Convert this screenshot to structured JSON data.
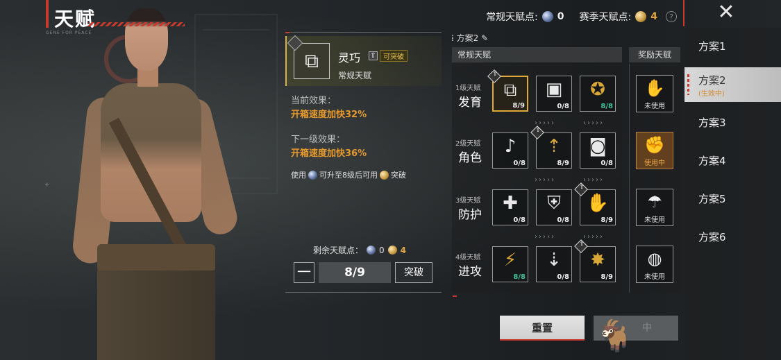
{
  "header": {
    "title": "天赋",
    "subtitle": "GENE FOR PEACE",
    "normal_points_label": "常规天赋点:",
    "normal_points_value": "0",
    "season_points_label": "赛季天赋点:",
    "season_points_value": "4",
    "help_icon": "question-icon",
    "close_icon": "close-icon"
  },
  "detail": {
    "name": "灵巧",
    "break_tag": "可突破",
    "type": "常规天赋",
    "current_label": "当前效果：",
    "current_value": "开箱速度加快32%",
    "next_label": "下一级效果：",
    "next_value": "开箱速度加快36%",
    "use_prefix": "使用",
    "use_middle": "可升至8级后可用",
    "use_suffix": "突破",
    "remain_label": "剩余天赋点：",
    "remain_normal": "0",
    "remain_season": "4",
    "minus": "一",
    "level": "8/9",
    "break_button": "突破"
  },
  "tree": {
    "plan_label": "方案2",
    "normal_header": "常规天赋",
    "reward_header": "奖励天赋",
    "rows": [
      {
        "level": "1级天赋",
        "name": "发育",
        "nodes": [
          {
            "icon": "supply-box-icon",
            "count": "8/9",
            "color": "white",
            "selected": true,
            "tag": true
          },
          {
            "icon": "suitcase-icon",
            "count": "0/8",
            "color": "white",
            "selected": false,
            "tag": false
          },
          {
            "icon": "runner-badge-icon",
            "count": "8/8",
            "color": "green",
            "selected": false,
            "tag": false,
            "gold": true
          }
        ]
      },
      {
        "level": "2级天赋",
        "name": "角色",
        "nodes": [
          {
            "icon": "sound-figure-icon",
            "count": "0/8",
            "color": "white",
            "selected": false,
            "tag": false
          },
          {
            "icon": "sprint-up-icon",
            "count": "8/9",
            "color": "white",
            "selected": false,
            "tag": true,
            "gold": true
          },
          {
            "icon": "backpack-up-icon",
            "count": "0/8",
            "color": "white",
            "selected": false,
            "tag": false
          }
        ]
      },
      {
        "level": "3级天赋",
        "name": "防护",
        "nodes": [
          {
            "icon": "medic-figure-icon",
            "count": "0/8",
            "color": "white",
            "selected": false,
            "tag": false
          },
          {
            "icon": "vest-icon",
            "count": "0/8",
            "color": "white",
            "selected": false,
            "tag": false
          },
          {
            "icon": "glove-icon",
            "count": "8/9",
            "color": "white",
            "selected": false,
            "tag": true,
            "gold": true
          }
        ]
      },
      {
        "level": "4级天赋",
        "name": "进攻",
        "nodes": [
          {
            "icon": "rifle-icon",
            "count": "8/8",
            "color": "green",
            "selected": false,
            "tag": false,
            "gold": true
          },
          {
            "icon": "melee-down-icon",
            "count": "0/8",
            "color": "white",
            "selected": false,
            "tag": false
          },
          {
            "icon": "shield-burst-icon",
            "count": "8/9",
            "color": "white",
            "selected": false,
            "tag": true,
            "gold": true
          }
        ]
      }
    ],
    "rewards": [
      {
        "icon": "hand-bag-icon",
        "status": "未使用",
        "active": false
      },
      {
        "icon": "strong-man-icon",
        "status": "使用中",
        "active": true
      },
      {
        "icon": "airdrop-icon",
        "status": "未使用",
        "active": false
      },
      {
        "icon": "grenade-icon",
        "status": "未使用",
        "active": false
      }
    ]
  },
  "buttons": {
    "reset": "重置",
    "confirm": "中"
  },
  "plans": [
    {
      "label": "方案1",
      "sub": ""
    },
    {
      "label": "方案2",
      "sub": "(生效中)",
      "active": true
    },
    {
      "label": "方案3",
      "sub": ""
    },
    {
      "label": "方案4",
      "sub": ""
    },
    {
      "label": "方案5",
      "sub": ""
    },
    {
      "label": "方案6",
      "sub": ""
    }
  ],
  "colors": {
    "accent_red": "#c73a30",
    "gold": "#e0a43a",
    "green": "#3fc29a",
    "effect_orange": "#e69a2e"
  }
}
